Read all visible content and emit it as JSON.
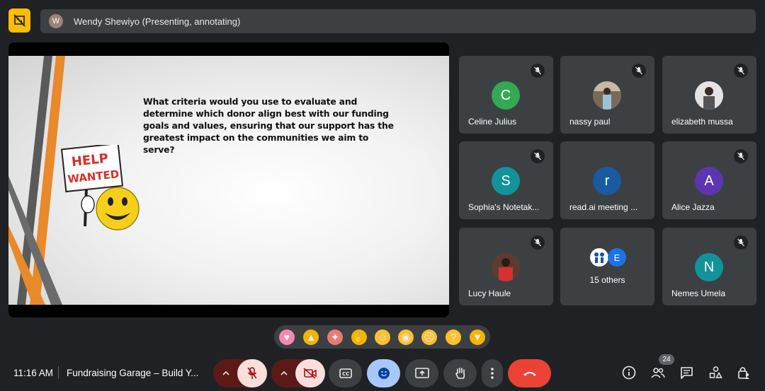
{
  "presenter": {
    "avatar_initial": "W",
    "label": "Wendy Shewiyo (Presenting, annotating)"
  },
  "slide": {
    "question": "What criteria would you use to evaluate and determine which donor align best with our funding goals and values, ensuring that our support has the greatest impact on the communities we aim to serve?",
    "sign_line1": "HELP",
    "sign_line2": "WANTED"
  },
  "participants": [
    {
      "name": "Celine Julius",
      "initial": "C",
      "color": "#34a853"
    },
    {
      "name": "nassy paul",
      "initial": "",
      "color": "#6d6d6d"
    },
    {
      "name": "elizabeth mussa",
      "initial": "",
      "color": "#8d8d8d"
    },
    {
      "name": "Sophia's Notetak...",
      "initial": "S",
      "color": "#12939a"
    },
    {
      "name": "read.ai meeting ...",
      "initial": "r",
      "color": "#1a5aa0"
    },
    {
      "name": "Alice Jazza",
      "initial": "A",
      "color": "#5e35b1"
    },
    {
      "name": "Lucy Haule",
      "initial": "",
      "color": "#6a4a3a"
    },
    {
      "name": "15 others",
      "initial": "E",
      "color": "#1a73e8"
    },
    {
      "name": "Nemes Umela",
      "initial": "N",
      "color": "#12939a"
    }
  ],
  "reactions": [
    "sparkling-heart",
    "thumbs-up",
    "party-popper",
    "clapping-hands",
    "tears-of-joy",
    "surprised",
    "sad",
    "thinking",
    "thumbs-down"
  ],
  "footer": {
    "time": "11:16 AM",
    "meeting_title": "Fundraising Garage – Build Y...",
    "people_count": "24"
  },
  "colors": {
    "background": "#202124",
    "tile": "#3c4043",
    "end_call": "#ea4335",
    "alert": "#fbbc04",
    "muted": "#f9dedc",
    "active": "#a8c7fa"
  }
}
